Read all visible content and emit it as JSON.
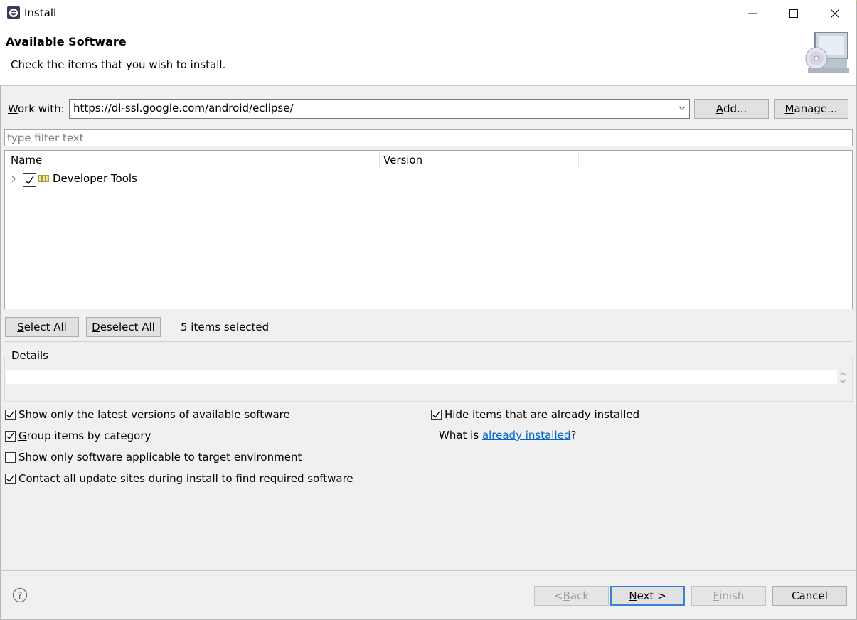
{
  "window": {
    "title": "Install",
    "minimize_glyph": "—",
    "maximize_glyph": "☐",
    "close_glyph": "✕"
  },
  "header": {
    "title": "Available Software",
    "description": "Check the items that you wish to install."
  },
  "work_with": {
    "label_prefix": "W",
    "label_rest": "ork with:",
    "value": "https://dl-ssl.google.com/android/eclipse/",
    "add_label_u": "A",
    "add_label_rest": "dd...",
    "manage_label_u": "M",
    "manage_label_rest": "anage..."
  },
  "filter": {
    "placeholder": "type filter text"
  },
  "tree": {
    "columns": [
      "Name",
      "Version"
    ],
    "items": [
      {
        "label": "Developer Tools",
        "checked": true,
        "expanded": false
      }
    ]
  },
  "selection": {
    "select_all_u": "S",
    "select_all_rest": "elect All",
    "deselect_all_u": "D",
    "deselect_all_rest": "eselect All",
    "status": "5 items selected"
  },
  "details": {
    "label": "Details"
  },
  "options": {
    "latest_pre": "Show only the ",
    "latest_u": "l",
    "latest_post": "atest versions of available software",
    "group_u": "G",
    "group_post": "roup items by category",
    "target_env": "Show only software applicable to target environment",
    "contact_u": "C",
    "contact_post": "ontact all update sites during install to find required software",
    "hide_u": "H",
    "hide_post": "ide items that are already installed",
    "what_is_prefix": "What is ",
    "what_is_link": "already installed",
    "what_is_suffix": "?"
  },
  "footer": {
    "help_glyph": "?",
    "back_pre": "< ",
    "back_u": "B",
    "back_post": "ack",
    "next_u": "N",
    "next_post": "ext >",
    "finish_u": "F",
    "finish_post": "inish",
    "cancel": "Cancel"
  },
  "colors": {
    "accent": "#3c7fd6",
    "link": "#0066cc",
    "title_border": "#e0c850"
  }
}
